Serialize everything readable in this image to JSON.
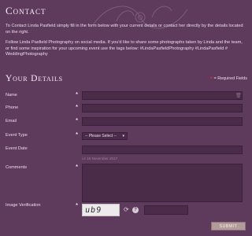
{
  "page": {
    "title": "Contact",
    "intro_1": "To Contact Linda Pasfield simply fill in the form below with your current details or contact her directly by the details located on the right.",
    "intro_2": "Follow Linda Pasfield Photography on social media. If you'd like to share some photographs taken by Linda and the team, or find some inspiration for your upcoming event use the tags below: #LindaPasfieldPhotography #LindaPasfield # WeddingPhotography"
  },
  "form": {
    "section_title": "Your Details",
    "required_note": "= Required Fields",
    "required_marker": "*",
    "name_label": "Name",
    "phone_label": "Phone",
    "email_label": "Email",
    "event_type_label": "Event Type",
    "event_type_selected": "-- Please Select --",
    "event_date_label": "Event Date",
    "event_date_hint": "i.e 16 November 2017",
    "comments_label": "Comments",
    "verification_label": "Image Verification",
    "captcha_text": "ub9",
    "help_glyph": "?",
    "refresh_glyph": "⟳",
    "trash_glyph": "🗑",
    "submit_label": "SUBMIT"
  },
  "colors": {
    "background": "#5e3a5d",
    "field": "#4a2c49",
    "required_star": "#ff2222",
    "submit": "#b49b9b"
  }
}
